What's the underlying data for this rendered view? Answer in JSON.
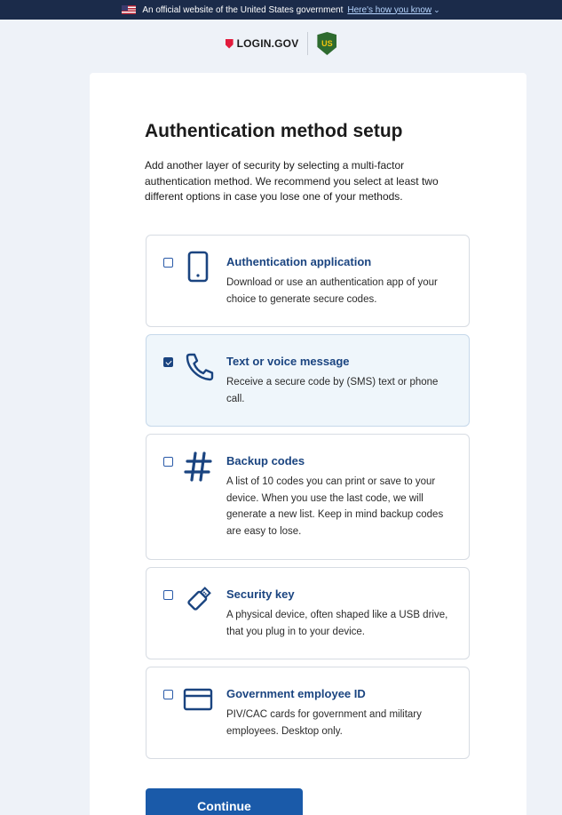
{
  "banner": {
    "text": "An official website of the United States government",
    "link": "Here's how you know",
    "chevron_icon": "chevron-down-icon"
  },
  "logo": {
    "login_text": "LOGIN.GOV",
    "partner_badge_text": "US",
    "partner_icon": "forest-service-shield-icon"
  },
  "page": {
    "title": "Authentication method setup",
    "intro": "Add another layer of security by selecting a multi-factor authentication method. We recommend you select at least two different options in case you lose one of your methods."
  },
  "options": [
    {
      "title": "Authentication application",
      "description": "Download or use an authentication app of your choice to generate secure codes.",
      "icon": "phone-device-icon",
      "checked": false
    },
    {
      "title": "Text or voice message",
      "description": "Receive a secure code by (SMS) text or phone call.",
      "icon": "phone-handset-icon",
      "checked": true
    },
    {
      "title": "Backup codes",
      "description": "A list of 10 codes you can print or save to your device. When you use the last code, we will generate a new list. Keep in mind backup codes are easy to lose.",
      "icon": "hashtag-icon",
      "checked": false
    },
    {
      "title": "Security key",
      "description": "A physical device, often shaped like a USB drive, that you plug in to your device.",
      "icon": "usb-key-icon",
      "checked": false
    },
    {
      "title": "Government employee ID",
      "description": "PIV/CAC cards for government and military employees. Desktop only.",
      "icon": "id-card-icon",
      "checked": false
    }
  ],
  "actions": {
    "continue_label": "Continue"
  },
  "colors": {
    "accent": "#1a4480",
    "button": "#1a5aa9",
    "page_background": "#eef2f8",
    "selected_background": "#eff6fb"
  }
}
